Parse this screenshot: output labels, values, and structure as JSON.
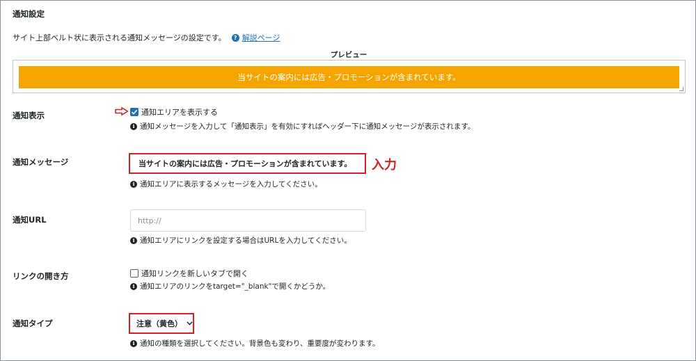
{
  "section": {
    "title": "通知設定",
    "description": "サイト上部ベルト状に表示される通知メッセージの設定です。",
    "help_icon": "question-circle-icon",
    "help_link": "解説ページ"
  },
  "preview": {
    "label": "プレビュー",
    "bar_text": "当サイトの案内には広告・プロモーションが含まれています。",
    "bar_color": "#f5a500"
  },
  "rows": {
    "display": {
      "label": "通知表示",
      "checkbox_label": "通知エリアを表示する",
      "checked": true,
      "note": "通知メッセージを入力して「通知表示」を有効にすればヘッダー下に通知メッセージが表示されます。"
    },
    "message": {
      "label": "通知メッセージ",
      "value": "当サイトの案内には広告・プロモーションが含まれています。",
      "annotation": "入力",
      "note": "通知エリアに表示するメッセージを入力してください。"
    },
    "url": {
      "label": "通知URL",
      "placeholder": "http://",
      "note": "通知エリアにリンクを設定する場合はURLを入力してください。"
    },
    "link_open": {
      "label": "リンクの開き方",
      "checkbox_label": "通知リンクを新しいタブで開く",
      "checked": false,
      "note": "通知エリアのリンクをtarget=\"_blank\"で開くかどうか。"
    },
    "type": {
      "label": "通知タイプ",
      "selected": "注意（黄色）",
      "note": "通知の種類を選択してください。背景色も変わり、重要度が変わります。"
    }
  },
  "colors": {
    "accent": "#2271b1",
    "highlight": "#d0202a"
  }
}
